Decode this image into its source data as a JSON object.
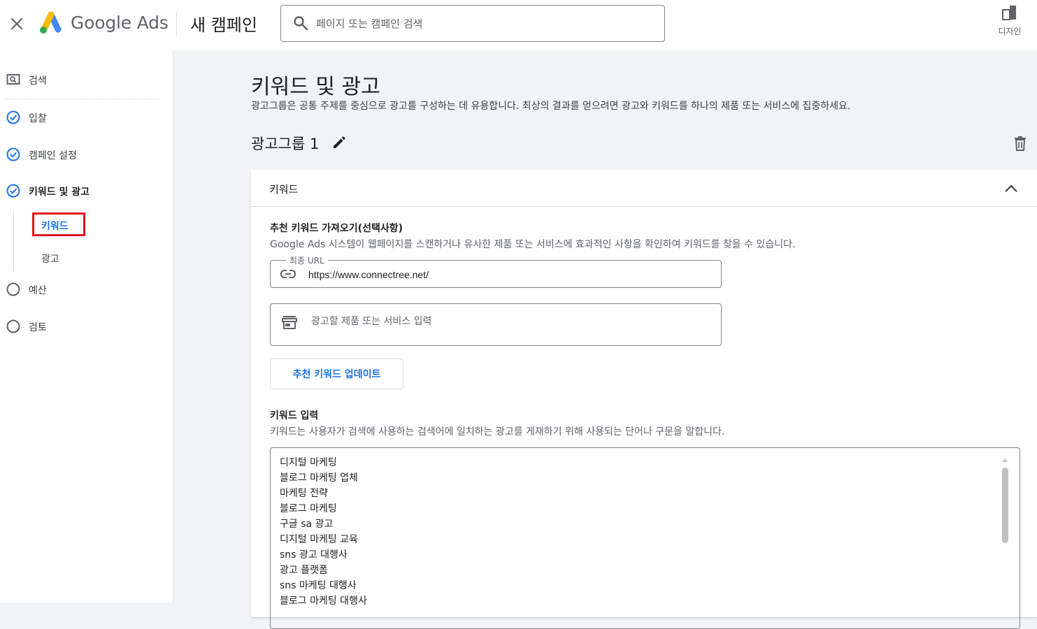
{
  "header": {
    "brand": "Google Ads",
    "campaign_title": "새 캠페인",
    "search_placeholder": "페이지 또는 캠페인 검색",
    "design_label": "디자인"
  },
  "sidebar": {
    "items": [
      {
        "label": "검색",
        "icon": "search-page-icon",
        "state": "none"
      },
      {
        "label": "입찰",
        "icon": "check-circle-icon",
        "state": "done"
      },
      {
        "label": "캠페인 설정",
        "icon": "check-circle-icon",
        "state": "done"
      },
      {
        "label": "키워드 및 광고",
        "icon": "check-circle-icon",
        "state": "current"
      },
      {
        "label": "예산",
        "icon": "empty-circle-icon",
        "state": "todo"
      },
      {
        "label": "검토",
        "icon": "empty-circle-icon",
        "state": "todo"
      }
    ],
    "sub_items": [
      {
        "label": "키워드",
        "active": true
      },
      {
        "label": "광고",
        "active": false
      }
    ]
  },
  "main": {
    "title": "키워드 및 광고",
    "description": "광고그룹은 공통 주제를 중심으로 광고를 구성하는 데 유용합니다. 최상의 결과를 얻으려면 광고와 키워드를 하나의 제품 또는 서비스에 집중하세요.",
    "ad_group_title": "광고그룹 1",
    "card": {
      "header": "키워드",
      "suggest_title": "추천 키워드 가져오기(선택사항)",
      "suggest_desc": "Google Ads 시스템이 웹페이지를 스캔하거나 유사한 제품 또는 서비스에 효과적인 사항을 확인하여 키워드를 찾을 수 있습니다.",
      "url_label": "최종 URL",
      "url_value": "https://www.connectree.net/",
      "product_placeholder": "광고할 제품 또는 서비스 입력",
      "update_button": "추천 키워드 업데이트",
      "keyword_input_title": "키워드 입력",
      "keyword_input_desc": "키워드는 사용자가 검색에 사용하는 검색어에 일치하는 광고를 게재하기 위해 사용되는 단어나 구문을 말합니다.",
      "keywords": [
        "디지털 마케팅",
        "블로그 마케팅 업체",
        "마케팅 전략",
        "블로그 마케팅",
        "구글 sa 광고",
        "디지털 마케팅 교육",
        "sns 광고 대행사",
        "광고 플랫폼",
        "sns 마케팅 대행사",
        "블로그 마케팅 대행사"
      ]
    }
  },
  "colors": {
    "accent": "#1a73e8",
    "highlight_border": "#e3161d",
    "logo_blue": "#4285f4",
    "logo_yellow": "#fbbc04",
    "logo_green": "#34a853"
  }
}
